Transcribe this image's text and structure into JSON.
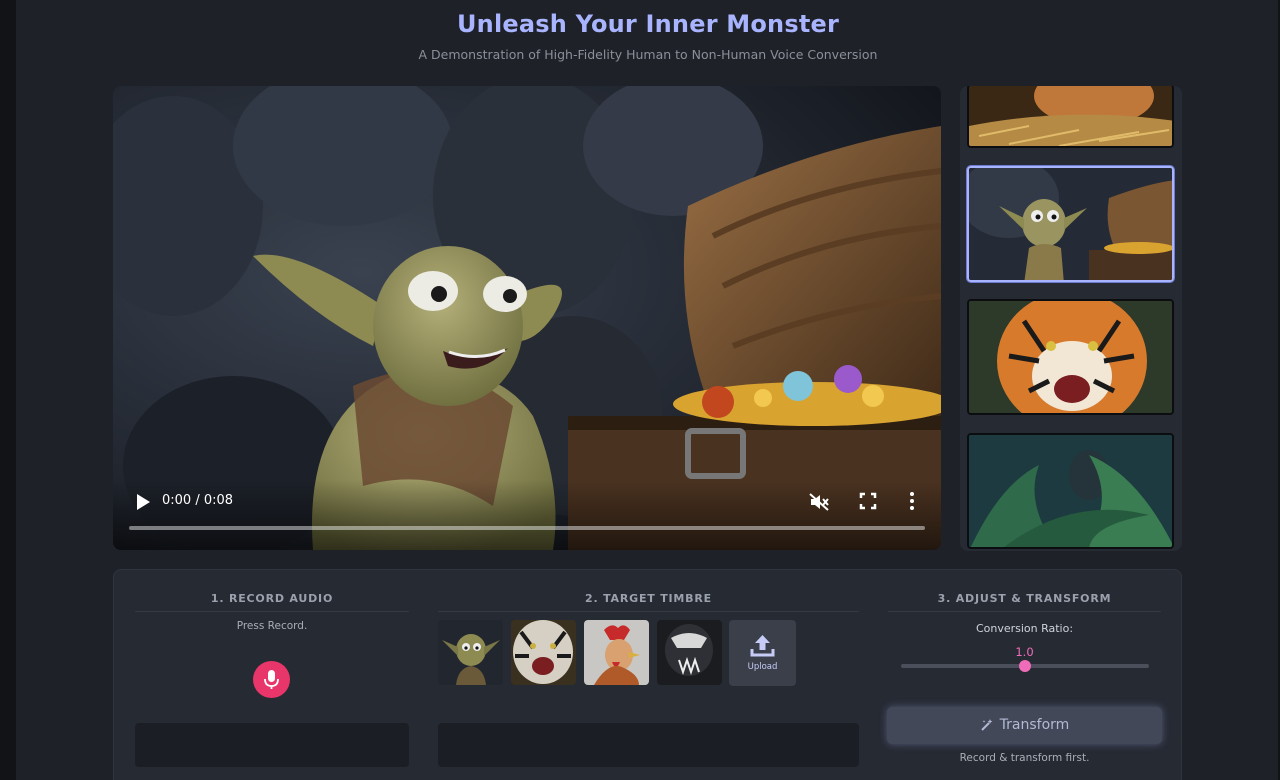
{
  "header": {
    "title": "Unleash Your Inner Monster",
    "subtitle": "A Demonstration of High-Fidelity Human to Non-Human Voice Conversion"
  },
  "video": {
    "time": "0:00 / 0:08",
    "progress": 0.0
  },
  "gallery": {
    "thumbnails": [
      "hen-nest",
      "goblin-treasure",
      "tiger-roar",
      "jungle-monster"
    ],
    "selected_index": 1
  },
  "record_section": {
    "title": "1. RECORD AUDIO",
    "status": "Press Record."
  },
  "timbre_section": {
    "title": "2. TARGET TIMBRE",
    "options": [
      "goblin",
      "tiger",
      "rooster",
      "black-beast"
    ],
    "upload_label": "Upload"
  },
  "adjust_section": {
    "title": "3. ADJUST & TRANSFORM",
    "ratio_label": "Conversion Ratio:",
    "ratio_value": "1.0",
    "ratio_fraction": 0.5,
    "transform_label": "Transform",
    "status": "Record & transform first."
  },
  "colors": {
    "accent": "#a9b4ff",
    "record": "#e8356a",
    "slider": "#f06cb8"
  }
}
